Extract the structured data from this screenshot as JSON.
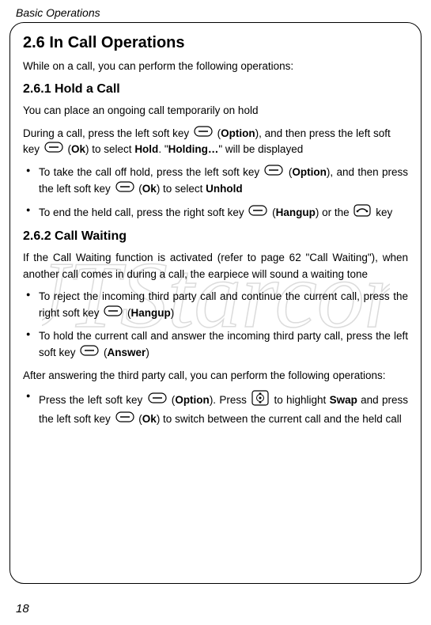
{
  "header": "Basic Operations",
  "section_title": "2.6 In Call Operations",
  "intro": "While on a call, you can perform the following operations:",
  "sub1": {
    "title": "2.6.1 Hold a Call",
    "p1": "You can place an ongoing call temporarily on hold",
    "p2_a": "During a call, press the left soft key ",
    "p2_b": " (",
    "p2_option": "Option",
    "p2_c": "), and then press the left soft key ",
    "p2_d": " (",
    "p2_ok": "Ok",
    "p2_e": ") to select ",
    "p2_hold": "Hold",
    "p2_f": ". \"",
    "p2_holding": "Holding…",
    "p2_g": "\" will be displayed",
    "li1_a": "To take the call off hold, press the left soft key ",
    "li1_b": " (",
    "li1_option": "Option",
    "li1_c": "), and then press the left soft key ",
    "li1_d": " (",
    "li1_ok": "Ok",
    "li1_e": ") to select ",
    "li1_unhold": "Unhold",
    "li2_a": "To end the held call, press the right soft key ",
    "li2_b": " (",
    "li2_hangup": "Hangup",
    "li2_c": ") or the ",
    "li2_d": " key"
  },
  "sub2": {
    "title": "2.6.2 Call Waiting",
    "p1": "If the Call Waiting function is activated (refer to page 62 \"Call Waiting\"), when another call comes in during a call, the earpiece will sound a waiting tone",
    "li1_a": "To reject the incoming third party call and continue the current call, press the right soft key  ",
    "li1_b": " (",
    "li1_hangup": "Hangup",
    "li1_c": ")",
    "li2_a": "To hold the current call and answer the incoming third party call, press the left soft key ",
    "li2_b": " (",
    "li2_answer": "Answer",
    "li2_c": ")",
    "p2": "After answering the third party call, you can perform the following operations:",
    "li3_a": "Press the left soft key ",
    "li3_b": " (",
    "li3_option": "Option",
    "li3_c": "). Press ",
    "li3_d": " to highlight ",
    "li3_swap": "Swap",
    "li3_e": " and press the left soft key ",
    "li3_f": " (",
    "li3_ok": "Ok",
    "li3_g": ") to switch between the current call and the held call"
  },
  "page_number": "18"
}
